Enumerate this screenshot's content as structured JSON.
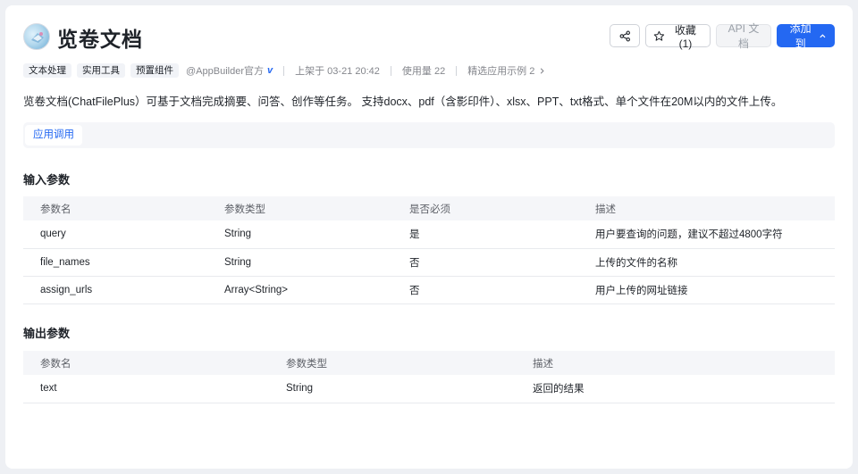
{
  "app": {
    "title": "览卷文档",
    "description": "览卷文档(ChatFilePlus）可基于文档完成摘要、问答、创作等任务。 支持docx、pdf（含影印件）、xlsx、PPT、txt格式、单个文件在20M以内的文件上传。"
  },
  "actions": {
    "favorite_label": "收藏(1)",
    "api_label": "API 文档",
    "add_label": "添加到"
  },
  "meta": {
    "tags": [
      "文本处理",
      "实用工具",
      "预置组件"
    ],
    "author": "@AppBuilder官方",
    "published": "上架于 03-21 20:42",
    "usage": "使用量 22",
    "examples": "精选应用示例 2"
  },
  "tabs": [
    "应用调用"
  ],
  "input_params": {
    "title": "输入参数",
    "columns": [
      "参数名",
      "参数类型",
      "是否必须",
      "描述"
    ],
    "rows": [
      [
        "query",
        "String",
        "是",
        "用户要查询的问题，建议不超过4800字符"
      ],
      [
        "file_names",
        "String",
        "否",
        "上传的文件的名称"
      ],
      [
        "assign_urls",
        "Array<String>",
        "否",
        "用户上传的网址链接"
      ]
    ]
  },
  "output_params": {
    "title": "输出参数",
    "columns": [
      "参数名",
      "参数类型",
      "描述"
    ],
    "rows": [
      [
        "text",
        "String",
        "返回的结果"
      ]
    ]
  },
  "colors": {
    "primary": "#2468f2",
    "text": "#1f2329",
    "muted": "#84868c",
    "header_bg": "#f5f6f9"
  },
  "icons": [
    "app-logo-icon",
    "share-icon",
    "star-icon",
    "chevron-up-icon",
    "verified-v-icon",
    "chevron-right-icon"
  ]
}
